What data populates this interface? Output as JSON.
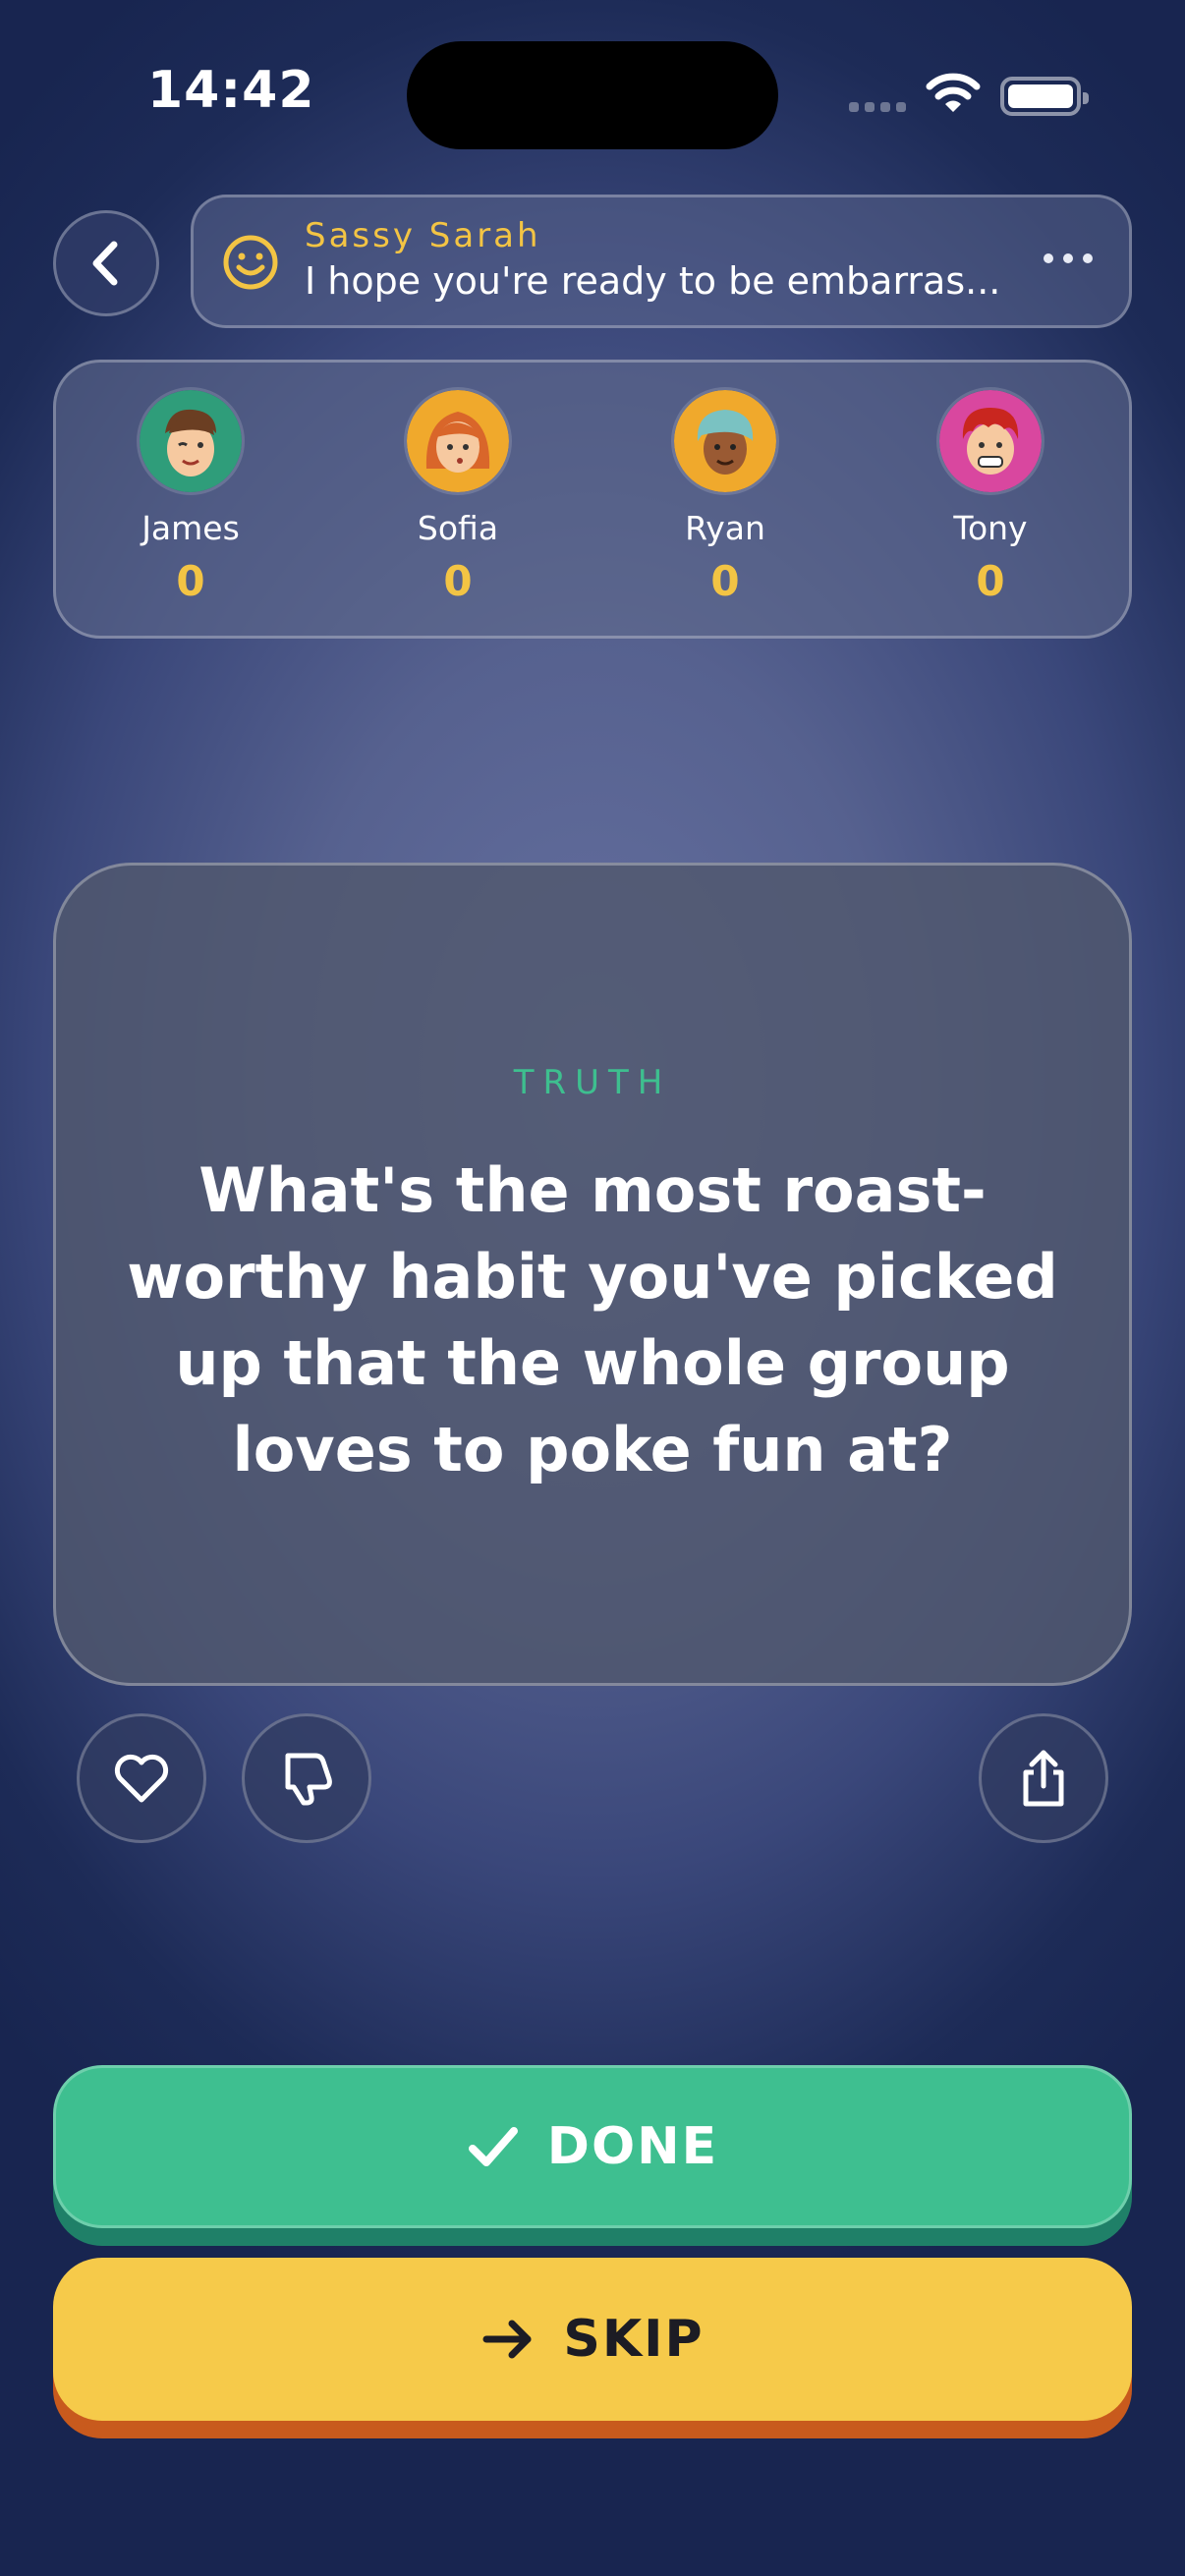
{
  "status_bar": {
    "time": "14:42"
  },
  "host": {
    "name": "Sassy Sarah",
    "message": "I hope you're ready to be embarras...",
    "icon": "smiley-icon"
  },
  "players": [
    {
      "name": "James",
      "score": "0",
      "avatar_color": "#2f9d7a"
    },
    {
      "name": "Sofia",
      "score": "0",
      "avatar_color": "#f0a92c"
    },
    {
      "name": "Ryan",
      "score": "0",
      "avatar_color": "#f0a92c"
    },
    {
      "name": "Tony",
      "score": "0",
      "avatar_color": "#d9479f"
    }
  ],
  "card": {
    "type": "TRUTH",
    "question": "What's the most roast-worthy habit you've picked up that the whole group loves to poke fun at?"
  },
  "buttons": {
    "done": "DONE",
    "skip": "SKIP"
  },
  "colors": {
    "accent_gold": "#f3c444",
    "done_green": "#3ebf90",
    "skip_yellow": "#f6ca4a",
    "truth_green": "#3ebf8f"
  }
}
